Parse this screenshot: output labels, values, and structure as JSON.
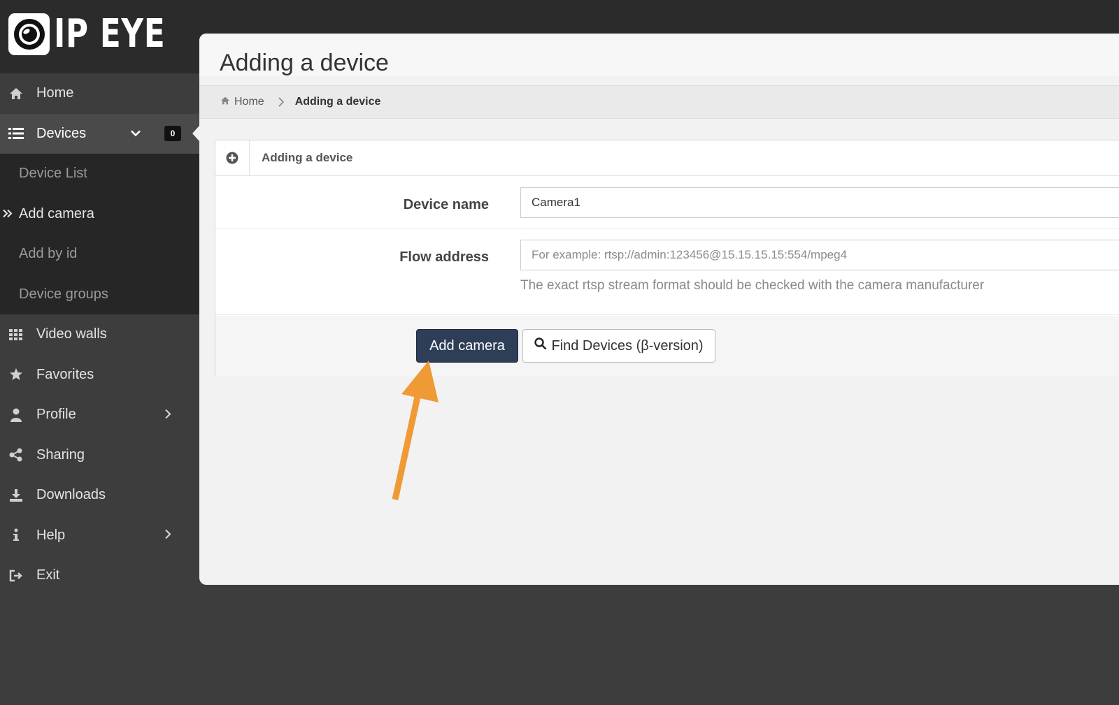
{
  "brand": {
    "logo_text": "IP EYE"
  },
  "sidebar": {
    "items": [
      {
        "label": "Home",
        "icon": "home-icon"
      },
      {
        "label": "Devices",
        "icon": "list-icon",
        "badge": "0"
      },
      {
        "label": "Video walls",
        "icon": "grid-icon"
      },
      {
        "label": "Favorites",
        "icon": "star-icon"
      },
      {
        "label": "Profile",
        "icon": "user-icon"
      },
      {
        "label": "Sharing",
        "icon": "share-icon"
      },
      {
        "label": "Downloads",
        "icon": "download-icon"
      },
      {
        "label": "Help",
        "icon": "info-icon"
      },
      {
        "label": "Exit",
        "icon": "sign-out-icon"
      }
    ],
    "devices_submenu": [
      "Device List",
      "Add camera",
      "Add by id",
      "Device groups"
    ]
  },
  "page": {
    "title": "Adding a device",
    "breadcrumb": {
      "home": "Home",
      "current": "Adding a device"
    }
  },
  "panel": {
    "title": "Adding a device",
    "device_name": {
      "label": "Device name",
      "value": "Camera1"
    },
    "flow_address": {
      "label": "Flow address",
      "placeholder": "For example: rtsp://admin:123456@15.15.15.15:554/mpeg4",
      "help": "The exact rtsp stream format should be checked with the camera manufacturer"
    },
    "buttons": {
      "add": "Add camera",
      "find": "Find Devices (β-version)"
    }
  },
  "colors": {
    "accent": "#2e3e57",
    "annotation_arrow": "#f09a36",
    "sidebar_bg": "#3d3d3d"
  }
}
